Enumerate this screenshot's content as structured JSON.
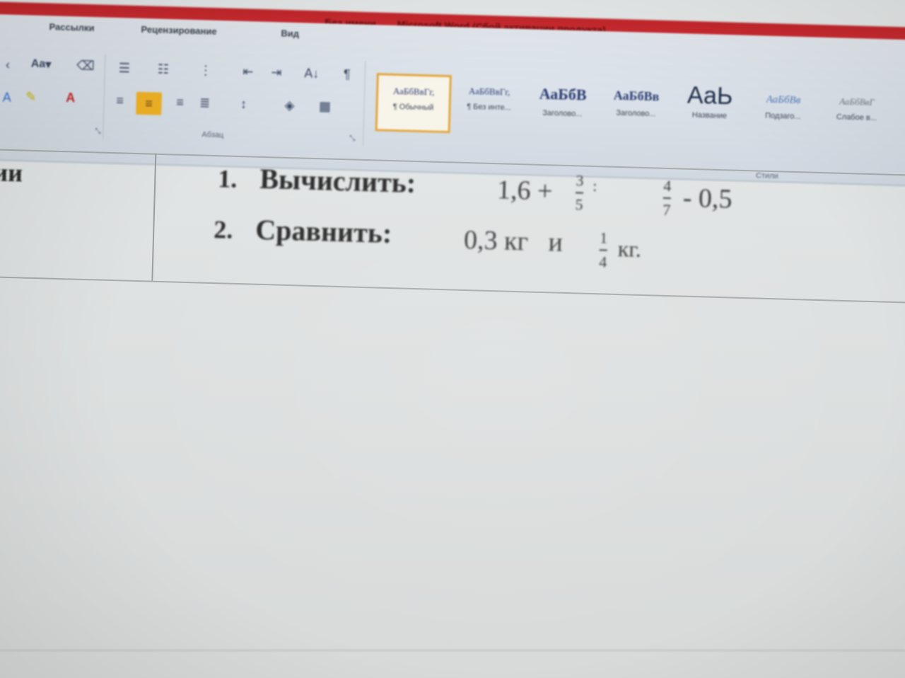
{
  "window": {
    "title_parts": [
      "Без имени",
      "Microsoft Word (Сбой активации продукта)"
    ]
  },
  "ribbon": {
    "tabs": [
      {
        "label": "Рассылки"
      },
      {
        "label": "Рецензирование"
      },
      {
        "label": "Вид"
      }
    ],
    "groups": {
      "font_caption": "",
      "paragraph_caption": "Абзац",
      "styles_caption": "Стили"
    },
    "font_controls": {
      "change_case_label": "Aa",
      "font_color_label": "A"
    },
    "paragraph_controls": {
      "show_marks_label": "¶",
      "sort_label": "А↓"
    },
    "styles": [
      {
        "sample": "АаБбВвГг,",
        "name": "¶ Обычный",
        "active": true
      },
      {
        "sample": "АаБбВвГг,",
        "name": "¶ Без инте...",
        "active": false
      },
      {
        "sample": "АаБбВ",
        "name": "Заголово...",
        "active": false
      },
      {
        "sample": "АаБбВв",
        "name": "Заголово...",
        "active": false
      },
      {
        "sample": "АаЬ",
        "name": "Название",
        "active": false
      },
      {
        "sample": "АаБбВв",
        "name": "Подзаго...",
        "active": false
      },
      {
        "sample": "АаБбВвГ",
        "name": "Слабое в...",
        "active": false
      }
    ]
  },
  "document": {
    "left_cell_fragment": "ии",
    "tasks": [
      {
        "number": "1.",
        "label": "Вычислить:",
        "expr_prefix": "1,6 +",
        "frac1_num": "3",
        "frac1_den": "5",
        "frac1_suffix": ":",
        "frac2_num": "4",
        "frac2_den": "7",
        "expr_suffix": "- 0,5"
      },
      {
        "number": "2.",
        "label": "Сравнить:",
        "expr_prefix": "0,3 кг   и",
        "frac1_num": "1",
        "frac1_den": "4",
        "expr_suffix": "кг."
      }
    ]
  },
  "colors": {
    "title_bar": "#cc2e33",
    "active_style_border": "#e3a63c",
    "center_align_highlight": "#f0b225"
  }
}
